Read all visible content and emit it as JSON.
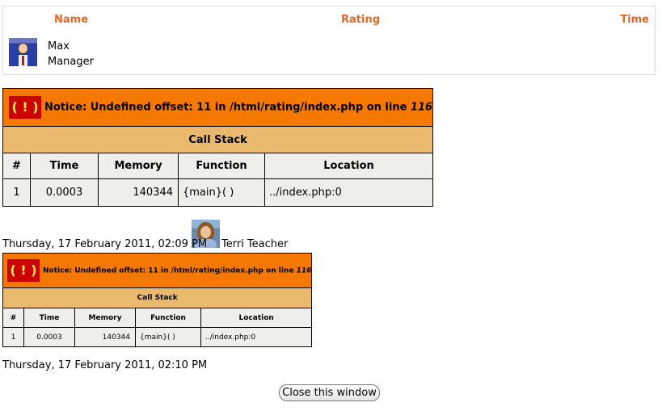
{
  "ratings": {
    "headers": {
      "name": "Name",
      "rating": "Rating",
      "time": "Time"
    },
    "user": {
      "name": "Max",
      "role": "Manager",
      "avatar_icon": "user-avatar-icon"
    }
  },
  "error1": {
    "bang": "( ! )",
    "notice_prefix": "Notice: Undefined offset: 11 in /html/rating/index.php on line ",
    "notice_line": "116",
    "call_stack": "Call Stack",
    "columns": [
      "#",
      "Time",
      "Memory",
      "Function",
      "Location"
    ],
    "row": {
      "num": "1",
      "time": "0.0003",
      "memory": "140344",
      "function": "{main}( )",
      "location": "../index.php:0"
    }
  },
  "entry1": {
    "date": "Thursday, 17 February 2011, 02:09 PM",
    "user": "Terri Teacher"
  },
  "error2": {
    "bang": "( ! )",
    "notice_prefix": "Notice: Undefined offset: 11 in /html/rating/index.php on line ",
    "notice_line": "116",
    "call_stack": "Call Stack",
    "columns": [
      "#",
      "Time",
      "Memory",
      "Function",
      "Location"
    ],
    "row": {
      "num": "1",
      "time": "0.0003",
      "memory": "140344",
      "function": "{main}( )",
      "location": "../index.php:0"
    }
  },
  "entry2": {
    "date": "Thursday, 17 February 2011, 02:10 PM"
  },
  "close_button": "Close this window",
  "colors": {
    "header_orange": "#e2692a",
    "notice_bg": "#f57900",
    "stack_bg": "#e9b96e",
    "cell_bg": "#eeeeec",
    "bang_bg": "#cc0000"
  }
}
